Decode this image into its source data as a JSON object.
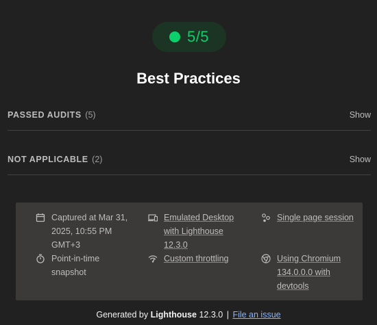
{
  "score": {
    "value": "5/5",
    "color": "#0cce6b"
  },
  "category": {
    "title": "Best Practices"
  },
  "groups": {
    "passed": {
      "label": "PASSED AUDITS",
      "count": "(5)",
      "action": "Show"
    },
    "not_applicable": {
      "label": "NOT APPLICABLE",
      "count": "(2)",
      "action": "Show"
    }
  },
  "environment": {
    "captured": {
      "icon": "calendar-icon",
      "line1": "Captured at Mar 31,",
      "line2": "2025, 10:55 PM",
      "line3": "GMT+3"
    },
    "emulated": {
      "icon": "devices-icon",
      "line1": "Emulated Desktop",
      "line2": "with Lighthouse",
      "line3": "12.3.0"
    },
    "session": {
      "icon": "session-icon",
      "line1": "Single page session"
    },
    "snapshot": {
      "icon": "stopwatch-icon",
      "line1": "Point-in-time",
      "line2": "snapshot"
    },
    "throttling": {
      "icon": "wifi-icon",
      "line1": "Custom throttling"
    },
    "browser": {
      "icon": "chrome-icon",
      "line1": "Using Chromium",
      "line2": "134.0.0.0 with",
      "line3": "devtools"
    }
  },
  "footer": {
    "prefix": "Generated by",
    "product": "Lighthouse",
    "version": "12.3.0",
    "separator": "|",
    "link": "File an issue"
  }
}
